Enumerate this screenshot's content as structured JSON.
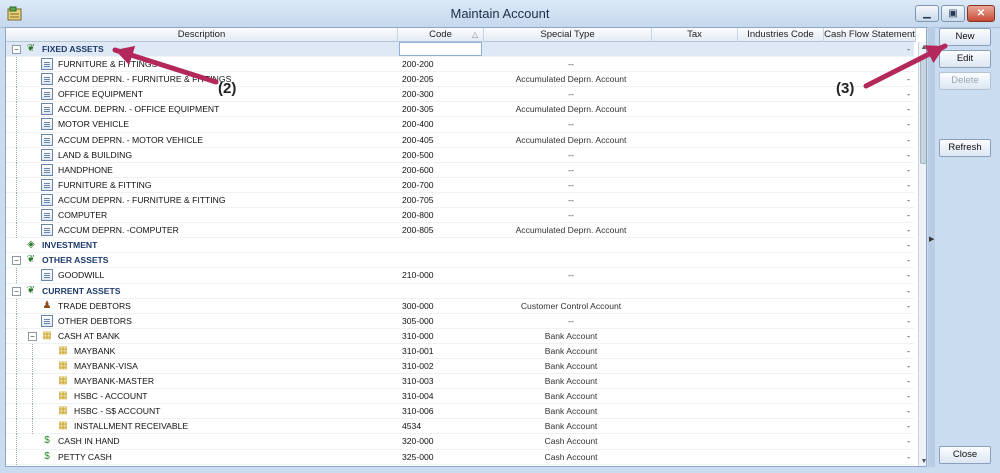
{
  "window": {
    "title": "Maintain Account",
    "app_icon": "ledger-icon",
    "minimize": "▁",
    "maximize": "▣",
    "close": "✕"
  },
  "columns": [
    "Description",
    "Code",
    "Special Type",
    "Tax",
    "Industries Code",
    "Cash Flow Statement"
  ],
  "rows": [
    {
      "level": 0,
      "desc": "FIXED ASSETS",
      "code": "",
      "special": "",
      "cash": "-",
      "icon": "group-icon",
      "expander": "⊟",
      "selected": true
    },
    {
      "level": 1,
      "desc": "FURNITURE & FITTINGS",
      "code": "200-200",
      "special": "--",
      "cash": "-",
      "icon": "document-icon"
    },
    {
      "level": 1,
      "desc": "ACCUM DEPRN. - FURNITURE & FITTINGS",
      "code": "200-205",
      "special": "Accumulated Deprn. Account",
      "cash": "-",
      "icon": "document-icon"
    },
    {
      "level": 1,
      "desc": "OFFICE EQUIPMENT",
      "code": "200-300",
      "special": "--",
      "cash": "-",
      "icon": "document-icon"
    },
    {
      "level": 1,
      "desc": "ACCUM. DEPRN. - OFFICE EQUIPMENT",
      "code": "200-305",
      "special": "Accumulated Deprn. Account",
      "cash": "-",
      "icon": "document-icon"
    },
    {
      "level": 1,
      "desc": "MOTOR VEHICLE",
      "code": "200-400",
      "special": "--",
      "cash": "-",
      "icon": "document-icon"
    },
    {
      "level": 1,
      "desc": "ACCUM DEPRN. - MOTOR VEHICLE",
      "code": "200-405",
      "special": "Accumulated Deprn. Account",
      "cash": "-",
      "icon": "document-icon"
    },
    {
      "level": 1,
      "desc": "LAND & BUILDING",
      "code": "200-500",
      "special": "--",
      "cash": "-",
      "icon": "document-icon"
    },
    {
      "level": 1,
      "desc": "HANDPHONE",
      "code": "200-600",
      "special": "--",
      "cash": "-",
      "icon": "document-icon"
    },
    {
      "level": 1,
      "desc": "FURNITURE & FITTING",
      "code": "200-700",
      "special": "--",
      "cash": "-",
      "icon": "document-icon"
    },
    {
      "level": 1,
      "desc": "ACCUM DEPRN. - FURNITURE & FITTING",
      "code": "200-705",
      "special": "--",
      "cash": "-",
      "icon": "document-icon"
    },
    {
      "level": 1,
      "desc": "COMPUTER",
      "code": "200-800",
      "special": "--",
      "cash": "-",
      "icon": "document-icon"
    },
    {
      "level": 1,
      "desc": "ACCUM DEPRN. -COMPUTER",
      "code": "200-805",
      "special": "Accumulated Deprn. Account",
      "cash": "-",
      "icon": "document-icon"
    },
    {
      "level": 0,
      "desc": "INVESTMENT",
      "code": "",
      "special": "",
      "cash": "-",
      "icon": "investment-icon",
      "expander": ""
    },
    {
      "level": 0,
      "desc": "OTHER ASSETS",
      "code": "",
      "special": "",
      "cash": "-",
      "icon": "group-icon",
      "expander": "⊟"
    },
    {
      "level": 1,
      "desc": "GOODWILL",
      "code": "210-000",
      "special": "--",
      "cash": "-",
      "icon": "document-icon"
    },
    {
      "level": 0,
      "desc": "CURRENT ASSETS",
      "code": "",
      "special": "",
      "cash": "-",
      "icon": "group-icon",
      "expander": "⊟"
    },
    {
      "level": 1,
      "desc": "TRADE DEBTORS",
      "code": "300-000",
      "special": "Customer Control Account",
      "cash": "-",
      "icon": "people-icon"
    },
    {
      "level": 1,
      "desc": "OTHER DEBTORS",
      "code": "305-000",
      "special": "--",
      "cash": "-",
      "icon": "document-icon"
    },
    {
      "level": 1,
      "desc": "CASH AT BANK",
      "code": "310-000",
      "special": "Bank Account",
      "cash": "-",
      "icon": "bank-icon",
      "expander": "⊟"
    },
    {
      "level": 2,
      "desc": "MAYBANK",
      "code": "310-001",
      "special": "Bank Account",
      "cash": "-",
      "icon": "bank-icon"
    },
    {
      "level": 2,
      "desc": "MAYBANK-VISA",
      "code": "310-002",
      "special": "Bank Account",
      "cash": "-",
      "icon": "bank-icon"
    },
    {
      "level": 2,
      "desc": "MAYBANK-MASTER",
      "code": "310-003",
      "special": "Bank Account",
      "cash": "-",
      "icon": "bank-icon"
    },
    {
      "level": 2,
      "desc": "HSBC - ACCOUNT",
      "code": "310-004",
      "special": "Bank Account",
      "cash": "-",
      "icon": "bank-icon"
    },
    {
      "level": 2,
      "desc": "HSBC - S$ ACCOUNT",
      "code": "310-006",
      "special": "Bank Account",
      "cash": "-",
      "icon": "bank-icon"
    },
    {
      "level": 2,
      "desc": "INSTALLMENT RECEIVABLE",
      "code": "4534",
      "special": "Bank Account",
      "cash": "-",
      "icon": "bank-icon"
    },
    {
      "level": 1,
      "desc": "CASH IN HAND",
      "code": "320-000",
      "special": "Cash Account",
      "cash": "-",
      "icon": "money-icon"
    },
    {
      "level": 1,
      "desc": "PETTY CASH",
      "code": "325-000",
      "special": "Cash Account",
      "cash": "-",
      "icon": "money-icon"
    }
  ],
  "side_buttons": {
    "new": "New",
    "edit": "Edit",
    "delete": "Delete",
    "refresh": "Refresh",
    "close": "Close"
  },
  "annotations": {
    "label_2": "(2)",
    "label_3": "(3)",
    "arrow_color": "#b3275a"
  },
  "colors": {
    "title_bar": "#c5d8ee",
    "selected_row": "#dfe9f5",
    "group_text": "#1d3a6b"
  }
}
